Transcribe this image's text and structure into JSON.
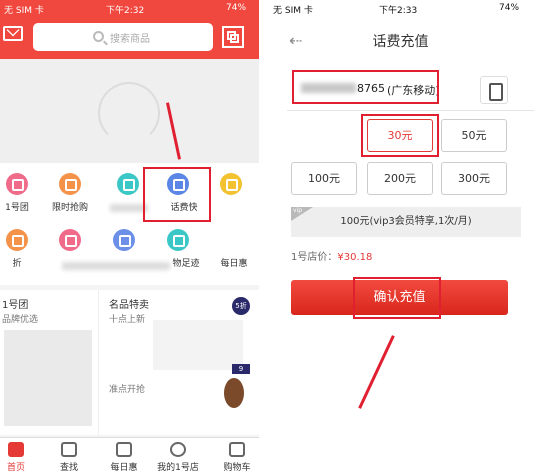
{
  "left": {
    "status": {
      "carrier": "无 SIM 卡",
      "time": "下午2:32",
      "battery": "74%"
    },
    "search": {
      "placeholder": "搜索商品"
    },
    "grid_row1": [
      "1号团",
      "限时抢购",
      "",
      "话费快",
      ""
    ],
    "grid_row2": [
      "折",
      "",
      "",
      "物足迹",
      "每日惠"
    ],
    "sections": {
      "left_title": "1号团",
      "left_sub": "品牌优选",
      "right_title": "名品特卖",
      "right_sub": "十点上新",
      "right_sub2": "准点开抢",
      "badge_5": "5折",
      "badge_9": "9"
    },
    "tabs": [
      "首页",
      "查找",
      "每日惠",
      "我的1号店",
      "购物车"
    ]
  },
  "right": {
    "status": {
      "carrier": "无 SIM 卡",
      "time": "下午2:33",
      "battery": "74%"
    },
    "title": "话费充值",
    "phone_suffix": "8765",
    "carrier_label": "(广东移动)",
    "amounts": [
      "30元",
      "50元",
      "100元",
      "200元",
      "300元"
    ],
    "vip_tag": "vip",
    "vip_text": "100元(vip3会员特享,1次/月)",
    "price_label": "1号店价：",
    "price_value": "¥30.18",
    "confirm_label": "确认充值"
  },
  "colors": {
    "brand_red": "#f0483e",
    "accent": "#e53935"
  }
}
